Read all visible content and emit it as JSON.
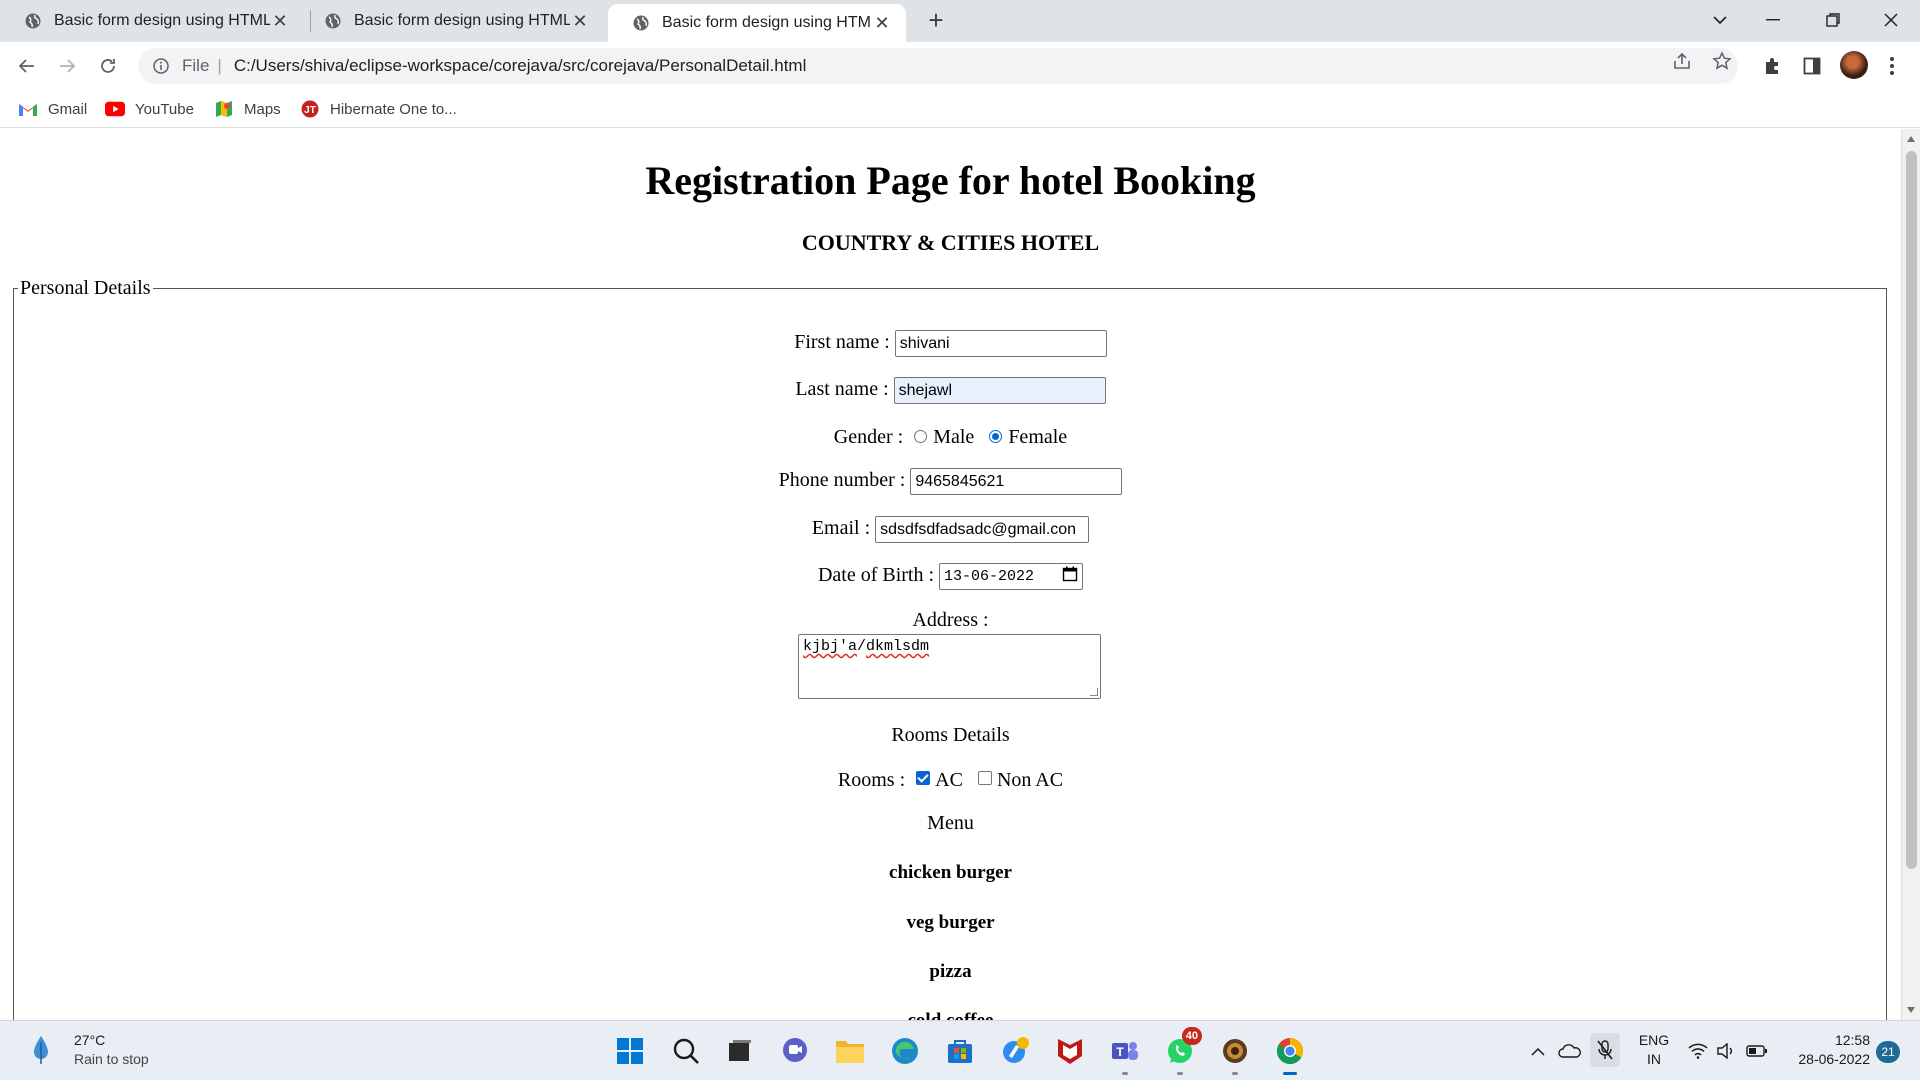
{
  "browser": {
    "tabs": [
      {
        "title": "Basic form design using HTML",
        "active": false
      },
      {
        "title": "Basic form design using HTML",
        "active": false
      },
      {
        "title": "Basic form design using HTML",
        "active": true
      }
    ],
    "new_tab": "+",
    "address": {
      "scheme_label": "File",
      "url": "C:/Users/shiva/eclipse-workspace/corejava/src/corejava/PersonalDetail.html"
    },
    "bookmarks": [
      {
        "label": "Gmail",
        "icon": "gmail-icon"
      },
      {
        "label": "YouTube",
        "icon": "youtube-icon"
      },
      {
        "label": "Maps",
        "icon": "maps-icon"
      },
      {
        "label": "Hibernate One to...",
        "icon": "hibernate-icon"
      }
    ]
  },
  "page": {
    "heading": "Registration Page for hotel Booking",
    "subheading": "COUNTRY & CITIES HOTEL",
    "legend": "Personal Details",
    "first_name": {
      "label": "First name :",
      "value": "shivani"
    },
    "last_name": {
      "label": "Last name :",
      "value": "shejawl"
    },
    "gender": {
      "label": "Gender :",
      "options": [
        "Male",
        "Female"
      ],
      "selected": "Female"
    },
    "phone": {
      "label": "Phone number :",
      "value": "9465845621"
    },
    "email": {
      "label": "Email :",
      "value": "sdsdfsdfadsadc@gmail.con"
    },
    "dob": {
      "label": "Date of Birth :",
      "value": "13-06-2022"
    },
    "address": {
      "label": "Address :",
      "value": "kjbj'a/dkmlsdm",
      "value_part1": "kjbj'a",
      "value_sep": "/",
      "value_part2": "dkmlsdm"
    },
    "rooms_details": "Rooms Details",
    "rooms": {
      "label": "Rooms :",
      "options": [
        "AC",
        "Non AC"
      ],
      "checked": [
        "AC"
      ]
    },
    "menu_title": "Menu",
    "menu_items": [
      "chicken burger",
      "veg burger",
      "pizza",
      "cold coffee"
    ]
  },
  "taskbar": {
    "weather": {
      "temp": "27°C",
      "desc": "Rain to stop"
    },
    "apps": [
      "start-icon",
      "search-icon",
      "task-view-icon",
      "chat-icon",
      "file-explorer-icon",
      "edge-icon",
      "store-icon",
      "app-icon",
      "mcafee-icon",
      "teams-icon",
      "whatsapp-icon",
      "game-icon",
      "chrome-icon"
    ],
    "whatsapp_badge": "40",
    "language": {
      "line1": "ENG",
      "line2": "IN"
    },
    "clock": {
      "time": "12:58",
      "date": "28-06-2022"
    },
    "notifications": "21"
  },
  "colors": {
    "accent": "#0a63d4",
    "autofill": "#e8f0fe",
    "tabstrip": "#dfe3e8",
    "taskbar": "#e9eef5"
  }
}
